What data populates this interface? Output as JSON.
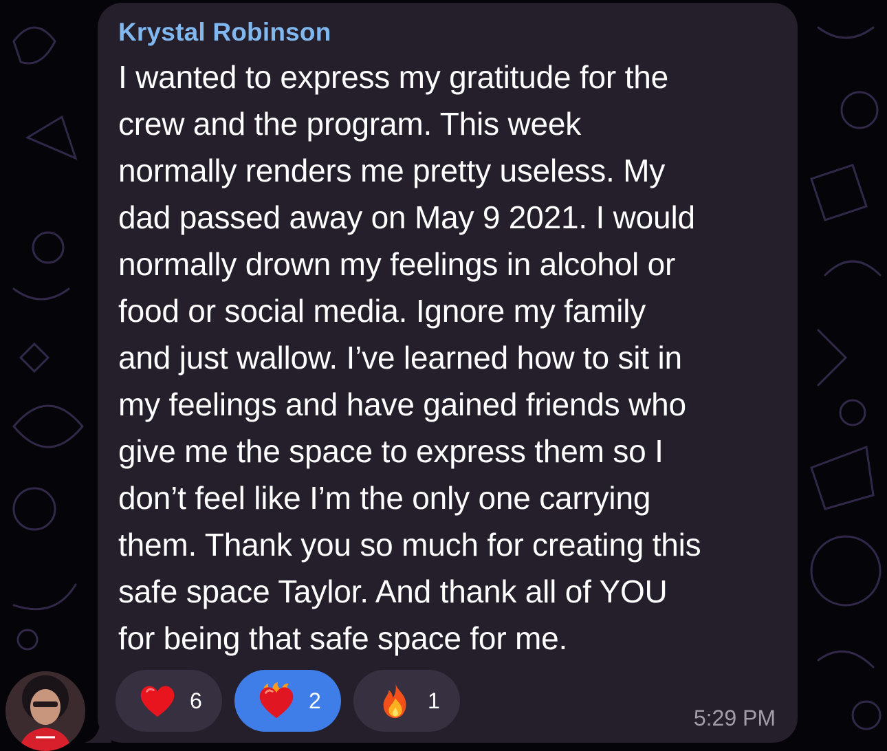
{
  "message": {
    "sender": "Krystal Robinson",
    "text_lines": [
      "I wanted to express my gratitude for the",
      "crew and the program. This week",
      "normally renders me pretty useless. My",
      "dad passed away on May 9 2021. I would",
      "normally drown my feelings in alcohol or",
      "food or social media. Ignore my family",
      "and just wallow. I’ve learned how to sit in",
      "my feelings and have gained friends who",
      "give me the space to express them so I",
      "don’t feel like I’m the only one carrying",
      "them. Thank you so much for creating this",
      "safe space Taylor. And thank all of YOU",
      "for being that safe space for me."
    ],
    "timestamp": "5:29 PM"
  },
  "reactions": [
    {
      "icon": "red-heart-icon",
      "count": "6",
      "active": false
    },
    {
      "icon": "heart-on-fire-icon",
      "count": "2",
      "active": true
    },
    {
      "icon": "fire-icon",
      "count": "1",
      "active": false
    }
  ],
  "colors": {
    "sender_name": "#82b8f0",
    "bubble": "#241f2b",
    "active_reaction": "#3f7ee8",
    "timestamp": "#a39daa"
  }
}
